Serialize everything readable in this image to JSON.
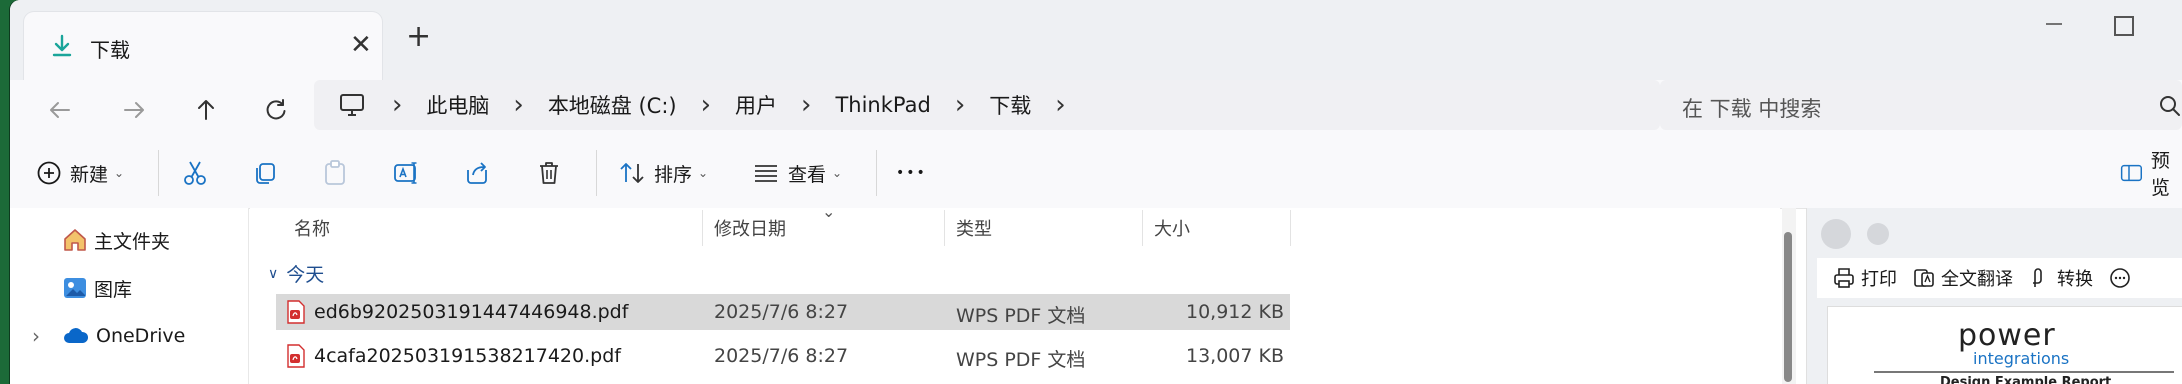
{
  "tab": {
    "title": "下载",
    "close_glyph": "✕",
    "new_tab_glyph": "+"
  },
  "window": {
    "minimize_glyph": "—"
  },
  "nav": {
    "back": "←",
    "forward": "→",
    "up": "↑",
    "refresh": "↻"
  },
  "breadcrumb": {
    "separator": "›",
    "items": [
      "此电脑",
      "本地磁盘 (C:)",
      "用户",
      "ThinkPad",
      "下载"
    ]
  },
  "search": {
    "placeholder": "在 下载 中搜索"
  },
  "commands": {
    "new_label": "新建",
    "sort_label": "排序",
    "view_label": "查看",
    "more_glyph": "•••",
    "preview_label": "预览"
  },
  "sidebar": {
    "items": [
      {
        "label": "主文件夹",
        "icon": "home-icon"
      },
      {
        "label": "图库",
        "icon": "gallery-icon"
      },
      {
        "label": "OneDrive",
        "icon": "cloud-icon"
      }
    ]
  },
  "table": {
    "columns": [
      "名称",
      "修改日期",
      "类型",
      "大小"
    ],
    "group": "今天",
    "rows": [
      {
        "name": "ed6b9202503191447446948.pdf",
        "date": "2025/7/6 8:27",
        "type": "WPS PDF 文档",
        "size": "10,912 KB",
        "selected": true
      },
      {
        "name": "4cafa202503191538217420.pdf",
        "date": "2025/7/6 8:27",
        "type": "WPS PDF 文档",
        "size": "13,007 KB",
        "selected": false
      }
    ]
  },
  "preview": {
    "actions": [
      "打印",
      "全文翻译",
      "转换"
    ],
    "logo_main": "power",
    "logo_sub": "integrations",
    "doc_title": "Design Example Report"
  },
  "colors": {
    "accent": "#1a73c4",
    "folder_blue": "#1f4e8f",
    "pdf_red": "#d32f2f",
    "selected_row": "#d9d9d9"
  }
}
